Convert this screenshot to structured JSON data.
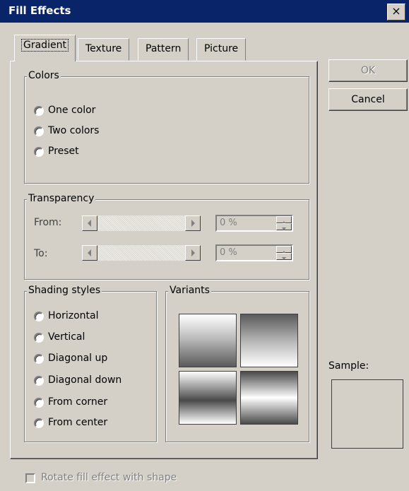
{
  "window": {
    "title": "Fill Effects",
    "close_glyph": "×"
  },
  "tabs": [
    {
      "label": "Gradient",
      "active": true
    },
    {
      "label": "Texture",
      "active": false
    },
    {
      "label": "Pattern",
      "active": false
    },
    {
      "label": "Picture",
      "active": false
    }
  ],
  "buttons": {
    "ok": "OK",
    "cancel": "Cancel",
    "ok_enabled": false
  },
  "colors": {
    "legend": "Colors",
    "options": [
      "One color",
      "Two colors",
      "Preset"
    ]
  },
  "transparency": {
    "legend": "Transparency",
    "from_label": "From:",
    "to_label": "To:",
    "from_value": "0 %",
    "to_value": "0 %"
  },
  "shading": {
    "legend": "Shading styles",
    "options": [
      "Horizontal",
      "Vertical",
      "Diagonal up",
      "Diagonal down",
      "From corner",
      "From center"
    ]
  },
  "variants": {
    "legend": "Variants"
  },
  "sample": {
    "label": "Sample:"
  },
  "footer": {
    "rotate_label": "Rotate fill effect with shape",
    "rotate_checked": false,
    "rotate_enabled": false
  },
  "theme": {
    "title_bar": "#0a246a",
    "face": "#d4d0c8",
    "shadow": "#808080"
  }
}
